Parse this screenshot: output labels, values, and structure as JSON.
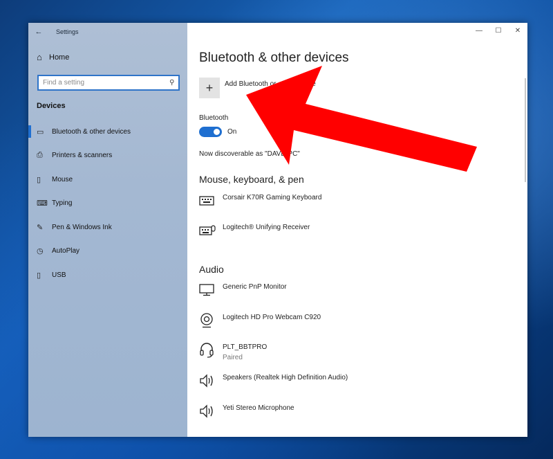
{
  "window": {
    "title": "Settings",
    "back_glyph": "←",
    "controls": {
      "minimize": "—",
      "maximize": "☐",
      "close": "✕"
    }
  },
  "sidebar": {
    "home": {
      "label": "Home",
      "icon": "home-icon",
      "glyph": "⌂"
    },
    "search": {
      "placeholder": "Find a setting"
    },
    "section": "Devices",
    "items": [
      {
        "label": "Bluetooth & other devices",
        "icon": "bluetooth-devices-icon",
        "glyph": "▭",
        "active": true
      },
      {
        "label": "Printers & scanners",
        "icon": "printer-icon",
        "glyph": "⎙",
        "active": false
      },
      {
        "label": "Mouse",
        "icon": "mouse-icon",
        "glyph": "▯",
        "active": false
      },
      {
        "label": "Typing",
        "icon": "keyboard-icon",
        "glyph": "⌨",
        "active": false
      },
      {
        "label": "Pen & Windows Ink",
        "icon": "pen-icon",
        "glyph": "✎",
        "active": false
      },
      {
        "label": "AutoPlay",
        "icon": "autoplay-icon",
        "glyph": "◷",
        "active": false
      },
      {
        "label": "USB",
        "icon": "usb-icon",
        "glyph": "▯",
        "active": false
      }
    ]
  },
  "main": {
    "title": "Bluetooth & other devices",
    "add_device": {
      "label": "Add Bluetooth or other device",
      "glyph": "+"
    },
    "bluetooth": {
      "label": "Bluetooth",
      "state": "On",
      "discoverable": "Now discoverable as \"DAVE-PC\""
    },
    "groups": [
      {
        "heading": "Mouse, keyboard, & pen",
        "devices": [
          {
            "name": "Corsair K70R Gaming Keyboard",
            "icon": "keyboard-icon",
            "status": ""
          },
          {
            "name": "Logitech® Unifying Receiver",
            "icon": "keyboard-mouse-icon",
            "status": ""
          }
        ]
      },
      {
        "heading": "Audio",
        "devices": [
          {
            "name": "Generic PnP Monitor",
            "icon": "monitor-icon",
            "status": ""
          },
          {
            "name": "Logitech HD Pro Webcam C920",
            "icon": "webcam-icon",
            "status": ""
          },
          {
            "name": "PLT_BBTPRO",
            "icon": "headset-icon",
            "status": "Paired"
          },
          {
            "name": "Speakers (Realtek High Definition Audio)",
            "icon": "speaker-icon",
            "status": ""
          },
          {
            "name": "Yeti Stereo Microphone",
            "icon": "speaker-icon",
            "status": ""
          }
        ]
      }
    ]
  },
  "overlay": {
    "arrow_color": "#ff0000",
    "accent": "#1f6fd0"
  }
}
